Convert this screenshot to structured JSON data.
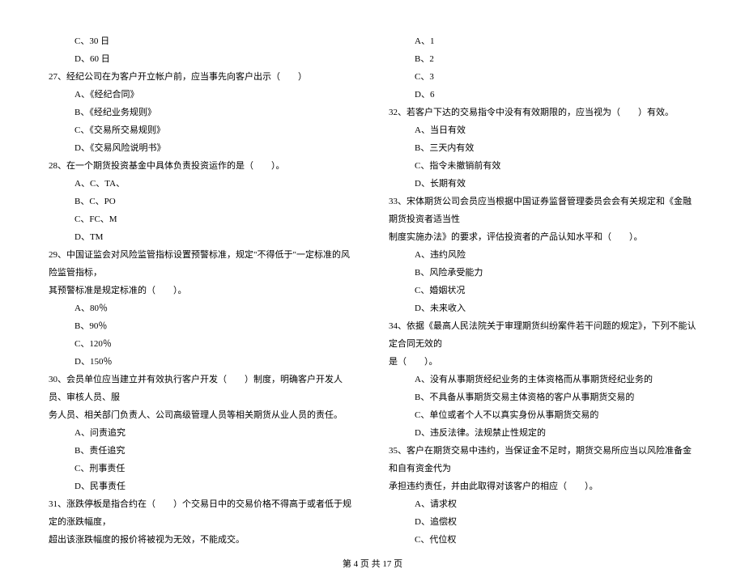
{
  "left": [
    {
      "type": "option",
      "text": "C、30 日"
    },
    {
      "type": "option",
      "text": "D、60 日"
    },
    {
      "type": "question",
      "text": "27、经纪公司在为客户开立帐户前，应当事先向客户出示（　　）"
    },
    {
      "type": "option",
      "text": "A、《经纪合同》"
    },
    {
      "type": "option",
      "text": "B、《经纪业务规则》"
    },
    {
      "type": "option",
      "text": "C、《交易所交易规则》"
    },
    {
      "type": "option",
      "text": "D、《交易风险说明书》"
    },
    {
      "type": "question",
      "text": "28、在一个期货投资基金中具体负责投资运作的是（　　）。"
    },
    {
      "type": "option",
      "text": "A、C、TA、"
    },
    {
      "type": "option",
      "text": "B、C、PO"
    },
    {
      "type": "option",
      "text": "C、FC、M"
    },
    {
      "type": "option",
      "text": "D、TM"
    },
    {
      "type": "question",
      "text": "29、中国证监会对风险监管指标设置预警标准，规定\"不得低于\"一定标准的风险监管指标，"
    },
    {
      "type": "continuation",
      "text": "其预警标准是规定标准的（　　）。"
    },
    {
      "type": "option",
      "text": "A、80％"
    },
    {
      "type": "option",
      "text": "B、90％"
    },
    {
      "type": "option",
      "text": "C、120％"
    },
    {
      "type": "option",
      "text": "D、150％"
    },
    {
      "type": "question",
      "text": "30、会员单位应当建立并有效执行客户开发（　　）制度，明确客户开发人员、审核人员、服"
    },
    {
      "type": "continuation",
      "text": "务人员、相关部门负责人、公司高级管理人员等相关期货从业人员的责任。"
    },
    {
      "type": "option",
      "text": "A、问责追究"
    },
    {
      "type": "option",
      "text": "B、责任追究"
    },
    {
      "type": "option",
      "text": "C、刑事责任"
    },
    {
      "type": "option",
      "text": "D、民事责任"
    },
    {
      "type": "question",
      "text": "31、涨跌停板是指合约在（　　）个交易日中的交易价格不得高于或者低于规定的涨跌幅度，"
    },
    {
      "type": "continuation",
      "text": "超出该涨跌幅度的报价将被视为无效，不能成交。"
    }
  ],
  "right": [
    {
      "type": "option",
      "text": "A、1"
    },
    {
      "type": "option",
      "text": "B、2"
    },
    {
      "type": "option",
      "text": "C、3"
    },
    {
      "type": "option",
      "text": "D、6"
    },
    {
      "type": "question",
      "text": "32、若客户下达的交易指令中没有有效期限的，应当视为（　　）有效。"
    },
    {
      "type": "option",
      "text": "A、当日有效"
    },
    {
      "type": "option",
      "text": "B、三天内有效"
    },
    {
      "type": "option",
      "text": "C、指令未撤销前有效"
    },
    {
      "type": "option",
      "text": "D、长期有效"
    },
    {
      "type": "question",
      "text": "33、宋体期货公司会员应当根据中国证券监督管理委员会会有关规定和《金融期货投资者适当性"
    },
    {
      "type": "continuation",
      "text": "制度实施办法》的要求，评估投资者的产品认知水平和（　　）。"
    },
    {
      "type": "option",
      "text": "A、违约风险"
    },
    {
      "type": "option",
      "text": "B、风险承受能力"
    },
    {
      "type": "option",
      "text": "C、婚姻状况"
    },
    {
      "type": "option",
      "text": "D、未来收入"
    },
    {
      "type": "question",
      "text": "34、依据《最高人民法院关于审理期货纠纷案件若干问题的规定》，下列不能认定合同无效的"
    },
    {
      "type": "continuation",
      "text": "是（　　）。"
    },
    {
      "type": "option",
      "text": "A、没有从事期货经纪业务的主体资格而从事期货经纪业务的"
    },
    {
      "type": "option",
      "text": "B、不具备从事期货交易主体资格的客户从事期货交易的"
    },
    {
      "type": "option",
      "text": "C、单位或者个人不以真实身份从事期货交易的"
    },
    {
      "type": "option",
      "text": "D、违反法律。法规禁止性规定的"
    },
    {
      "type": "question",
      "text": "35、客户在期货交易中违约，当保证金不足时，期货交易所应当以风险准备金和自有资金代为"
    },
    {
      "type": "continuation",
      "text": "承担违约责任，并由此取得对该客户的相应（　　）。"
    },
    {
      "type": "option",
      "text": "A、请求权"
    },
    {
      "type": "option",
      "text": "D、追偿权"
    },
    {
      "type": "option",
      "text": "C、代位权"
    }
  ],
  "footer": "第 4 页 共 17 页"
}
